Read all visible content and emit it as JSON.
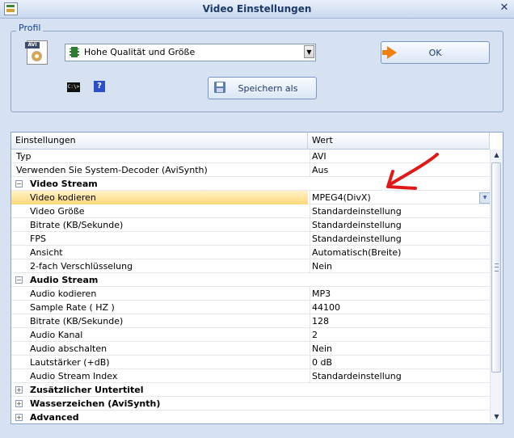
{
  "window": {
    "title": "Video Einstellungen",
    "close_glyph": "✕"
  },
  "profile": {
    "group_label": "Profil",
    "selected": "Hohe Qualität und Größe",
    "ok_label": "OK",
    "save_as_label": "Speichern als",
    "avi_icon_label": "AVI",
    "cmd_icon_label": "C:\\>",
    "help_icon_label": "?"
  },
  "grid": {
    "columns": [
      "Einstellungen",
      "Wert"
    ],
    "rows": [
      {
        "name": "Typ",
        "value": "AVI"
      },
      {
        "name": "Verwenden Sie System-Decoder (AviSynth)",
        "value": "Aus"
      },
      {
        "name": "Video Stream",
        "category": true,
        "expander": "−"
      },
      {
        "name": "Video kodieren",
        "value": "MPEG4(DivX)",
        "selected": true
      },
      {
        "name": "Video Größe",
        "value": "Standardeinstellung"
      },
      {
        "name": "Bitrate (KB/Sekunde)",
        "value": "Standardeinstellung"
      },
      {
        "name": "FPS",
        "value": "Standardeinstellung"
      },
      {
        "name": "Ansicht",
        "value": "Automatisch(Breite)"
      },
      {
        "name": "2-fach Verschlüsselung",
        "value": "Nein"
      },
      {
        "name": "Audio Stream",
        "category": true,
        "expander": "−"
      },
      {
        "name": "Audio kodieren",
        "value": "MP3"
      },
      {
        "name": "Sample Rate ( HZ )",
        "value": "44100"
      },
      {
        "name": "Bitrate (KB/Sekunde)",
        "value": "128"
      },
      {
        "name": "Audio Kanal",
        "value": "2"
      },
      {
        "name": "Audio abschalten",
        "value": "Nein"
      },
      {
        "name": "Lautstärker  (+dB)",
        "value": "0 dB"
      },
      {
        "name": "Audio Stream Index",
        "value": "Standardeinstellung"
      },
      {
        "name": "Zusätzlicher Untertitel",
        "category": true,
        "expander": "+"
      },
      {
        "name": "Wasserzeichen (AviSynth)",
        "category": true,
        "expander": "+"
      },
      {
        "name": "Advanced",
        "category": true,
        "expander": "+"
      }
    ]
  },
  "colors": {
    "annotation_arrow": "#e01818",
    "selected_row": "#ffd87a",
    "window_bg": "#d6e2f2"
  }
}
